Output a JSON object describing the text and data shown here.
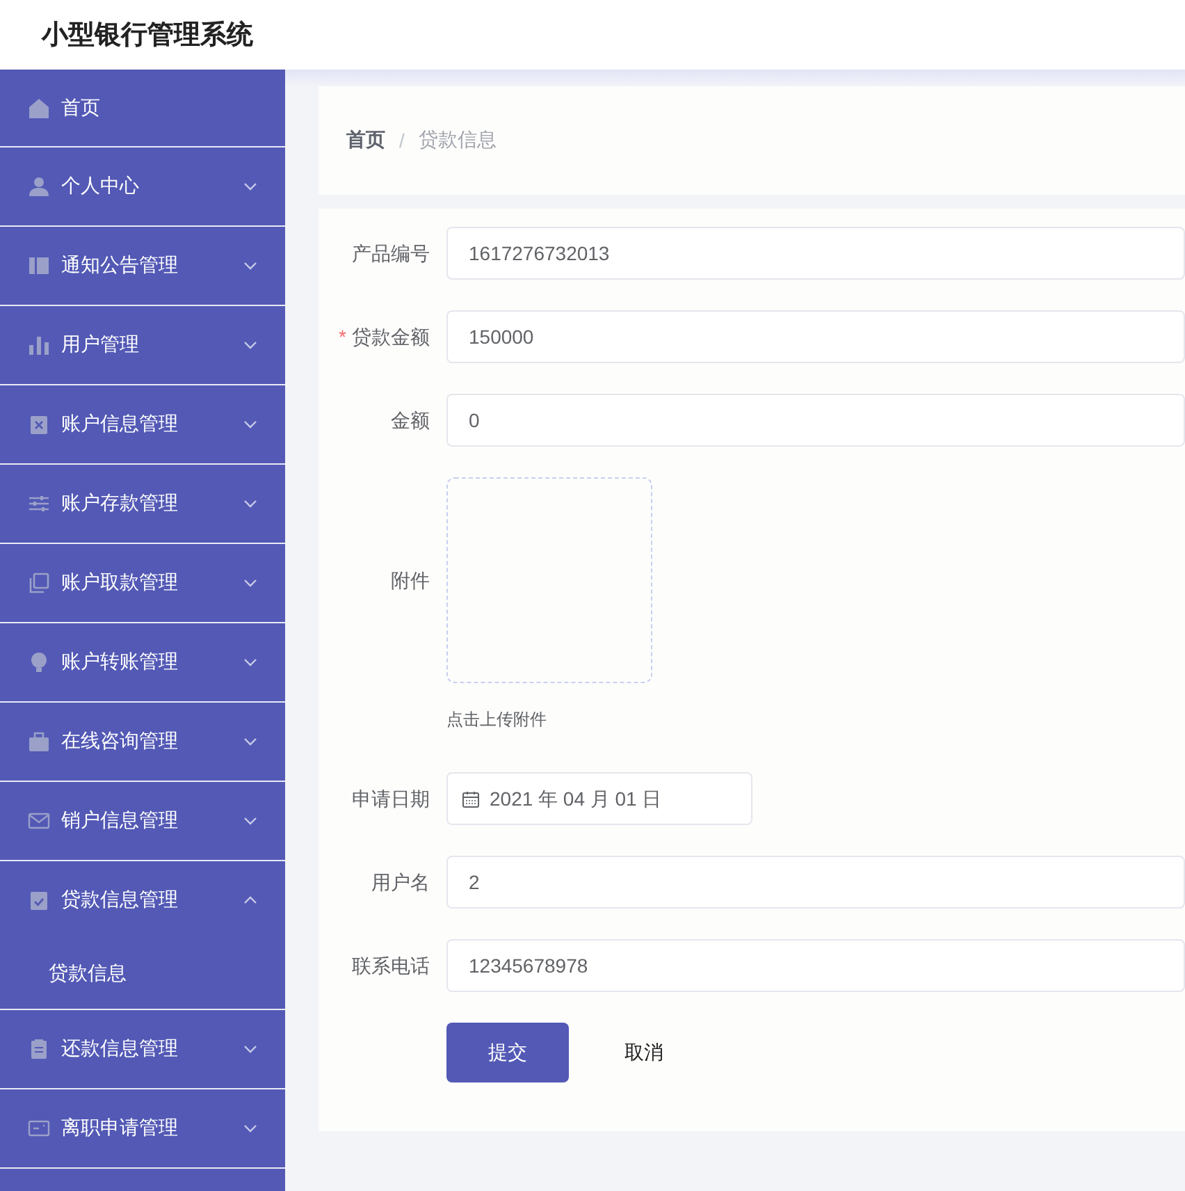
{
  "header": {
    "title": "小型银行管理系统"
  },
  "sidebar": {
    "items": [
      {
        "label": "首页",
        "kind": "link"
      },
      {
        "label": "个人中心",
        "kind": "submenu",
        "expanded": false
      },
      {
        "label": "通知公告管理",
        "kind": "submenu",
        "expanded": false
      },
      {
        "label": "用户管理",
        "kind": "submenu",
        "expanded": false
      },
      {
        "label": "账户信息管理",
        "kind": "submenu",
        "expanded": false
      },
      {
        "label": "账户存款管理",
        "kind": "submenu",
        "expanded": false
      },
      {
        "label": "账户取款管理",
        "kind": "submenu",
        "expanded": false
      },
      {
        "label": "账户转账管理",
        "kind": "submenu",
        "expanded": false
      },
      {
        "label": "在线咨询管理",
        "kind": "submenu",
        "expanded": false
      },
      {
        "label": "销户信息管理",
        "kind": "submenu",
        "expanded": false
      },
      {
        "label": "贷款信息管理",
        "kind": "submenu",
        "expanded": true,
        "children": [
          {
            "label": "贷款信息"
          }
        ]
      },
      {
        "label": "还款信息管理",
        "kind": "submenu",
        "expanded": false
      },
      {
        "label": "离职申请管理",
        "kind": "submenu",
        "expanded": false
      }
    ]
  },
  "breadcrumb": {
    "separator": "/",
    "items": [
      "首页",
      "贷款信息"
    ]
  },
  "form": {
    "required_mark": "*",
    "fields": [
      {
        "label": "产品编号",
        "kind": "text",
        "required": false,
        "value": "1617276732013"
      },
      {
        "label": "贷款金额",
        "kind": "text",
        "required": true,
        "value": "150000"
      },
      {
        "label": "金额",
        "kind": "text",
        "required": false,
        "value": "0"
      },
      {
        "label": "附件",
        "kind": "upload",
        "required": false,
        "hint": "点击上传附件"
      },
      {
        "label": "申请日期",
        "kind": "date",
        "required": false,
        "value": "2021 年 04 月 01 日"
      },
      {
        "label": "用户名",
        "kind": "text",
        "required": false,
        "value": "2"
      },
      {
        "label": "联系电话",
        "kind": "text",
        "required": false,
        "value": "12345678978"
      }
    ],
    "buttons": [
      {
        "label": "提交",
        "kind": "primary"
      },
      {
        "label": "取消",
        "kind": "plain"
      }
    ]
  }
}
